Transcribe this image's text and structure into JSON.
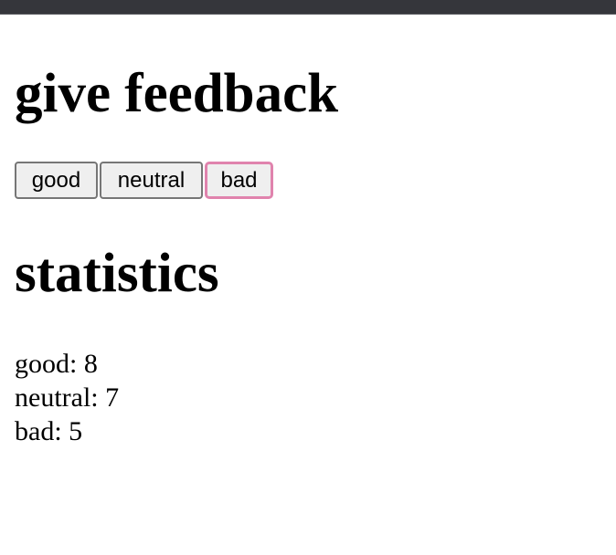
{
  "feedback": {
    "heading": "give feedback",
    "buttons": {
      "good": "good",
      "neutral": "neutral",
      "bad": "bad"
    }
  },
  "statistics": {
    "heading": "statistics",
    "lines": {
      "good": "good: 8",
      "neutral": "neutral: 7",
      "bad": "bad: 5"
    }
  },
  "colors": {
    "top_bar": "#35363b",
    "focus_ring": "#e083ad",
    "button_bg": "#efefef",
    "button_border": "#767676"
  }
}
